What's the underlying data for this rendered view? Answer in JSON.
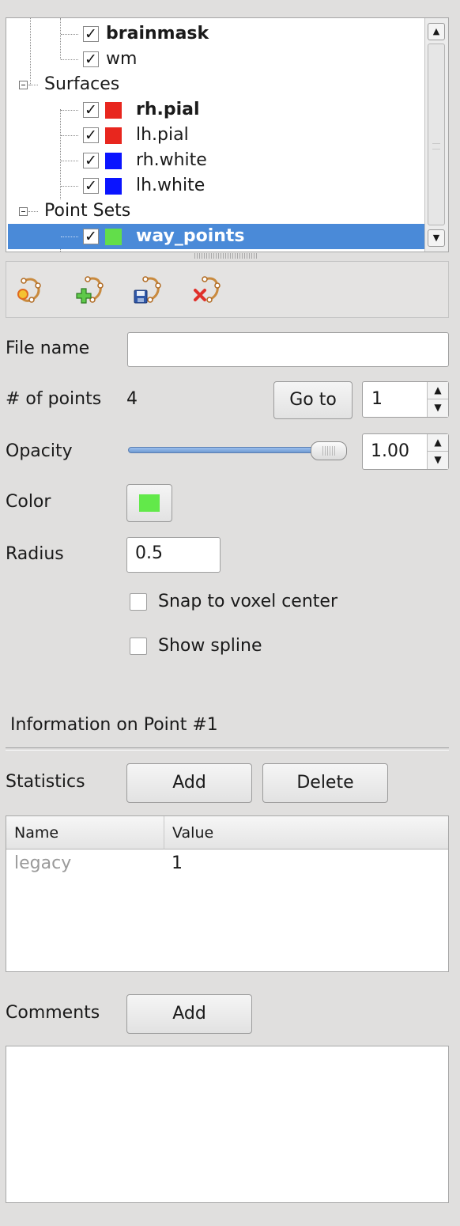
{
  "tree": {
    "items": [
      {
        "label": "brainmask",
        "bold": true,
        "checked": true
      },
      {
        "label": "wm",
        "bold": false,
        "checked": true
      },
      {
        "label": "Surfaces",
        "group": true
      },
      {
        "label": "rh.pial",
        "bold": true,
        "checked": true,
        "color": "#e8261e"
      },
      {
        "label": "lh.pial",
        "bold": false,
        "checked": true,
        "color": "#e8261e"
      },
      {
        "label": "rh.white",
        "bold": false,
        "checked": true,
        "color": "#0a14ff"
      },
      {
        "label": "lh.white",
        "bold": false,
        "checked": true,
        "color": "#0a14ff"
      },
      {
        "label": "Point Sets",
        "group": true
      },
      {
        "label": "way_points",
        "bold": true,
        "checked": true,
        "color": "#62de4a",
        "selected": true
      }
    ],
    "checkmark": "✓"
  },
  "toolbar": {
    "icons": [
      "new-point-set-icon",
      "add-point-icon",
      "save-point-set-icon",
      "remove-point-set-icon"
    ]
  },
  "form": {
    "file_name_label": "File name",
    "file_name_value": "",
    "num_points_label": "# of points",
    "num_points_value": "4",
    "goto_button": "Go to",
    "goto_index": "1",
    "opacity_label": "Opacity",
    "opacity_value": "1.00",
    "opacity_fraction": 1.0,
    "color_label": "Color",
    "color_value": "#62e94a",
    "radius_label": "Radius",
    "radius_value": "0.5",
    "snap_label": "Snap to voxel center",
    "snap_checked": false,
    "spline_label": "Show spline",
    "spline_checked": false
  },
  "info": {
    "title": "Information on Point #1",
    "statistics_label": "Statistics",
    "add_button": "Add",
    "delete_button": "Delete",
    "table": {
      "headers": [
        "Name",
        "Value"
      ],
      "rows": [
        [
          "legacy",
          "1"
        ]
      ]
    },
    "comments_label": "Comments",
    "comments_add_button": "Add"
  }
}
